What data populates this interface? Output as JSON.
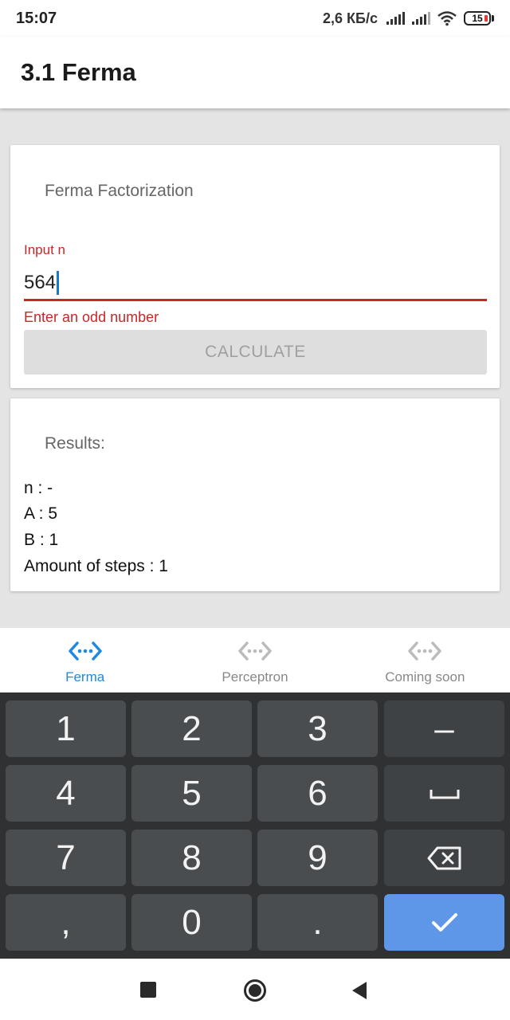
{
  "status_bar": {
    "time": "15:07",
    "network_speed": "2,6 КБ/с",
    "battery_level": "15",
    "icons": [
      "signal-icon",
      "signal-icon",
      "wifi-icon",
      "battery-icon"
    ]
  },
  "app_bar": {
    "title": "3.1 Ferma"
  },
  "factorization_card": {
    "title": "Ferma Factorization",
    "input_label": "Input n",
    "input_value": "564",
    "error_text": "Enter an odd number",
    "button_label": "CALCULATE"
  },
  "results_card": {
    "title": "Results:",
    "lines": [
      "n : -",
      "A : 5",
      "B : 1",
      "Amount of steps : 1"
    ]
  },
  "bottom_nav": {
    "items": [
      {
        "label": "Ferma",
        "icon": "code-arrows-icon",
        "active": true
      },
      {
        "label": "Perceptron",
        "icon": "code-arrows-icon",
        "active": false
      },
      {
        "label": "Coming soon",
        "icon": "code-arrows-icon",
        "active": false
      }
    ]
  },
  "keyboard": {
    "keys": [
      "1",
      "2",
      "3",
      "–",
      "4",
      "5",
      "6",
      "space",
      "7",
      "8",
      "9",
      "backspace",
      ",",
      "0",
      ".",
      "done"
    ],
    "labels": {
      "k1": "1",
      "k2": "2",
      "k3": "3",
      "minus": "–",
      "k4": "4",
      "k5": "5",
      "k6": "6",
      "k7": "7",
      "k8": "8",
      "k9": "9",
      "comma": ",",
      "k0": "0",
      "period": "."
    }
  },
  "system_nav": {
    "icons": [
      "recent-apps-icon",
      "home-icon",
      "back-icon"
    ]
  },
  "colors": {
    "accent": "#1e88e5",
    "error": "#c62828",
    "done_key": "#5e97e8",
    "keyboard_bg": "#2f3133"
  }
}
